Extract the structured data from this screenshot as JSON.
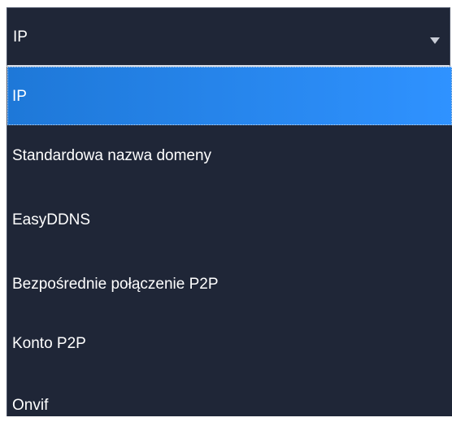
{
  "select": {
    "value": "IP",
    "arrow_icon": "caret-down-icon"
  },
  "options": [
    {
      "label": "IP",
      "selected": true
    },
    {
      "label": "Standardowa nazwa domeny",
      "selected": false
    },
    {
      "label": "EasyDDNS",
      "selected": false
    },
    {
      "label": "Bezpośrednie połączenie P2P",
      "selected": false
    },
    {
      "label": "Konto P2P",
      "selected": false
    },
    {
      "label": "Onvif",
      "selected": false
    }
  ],
  "colors": {
    "background": "#1f2637",
    "selected_start": "#1e78d8",
    "selected_end": "#2f92ff",
    "text": "#ffffff"
  }
}
